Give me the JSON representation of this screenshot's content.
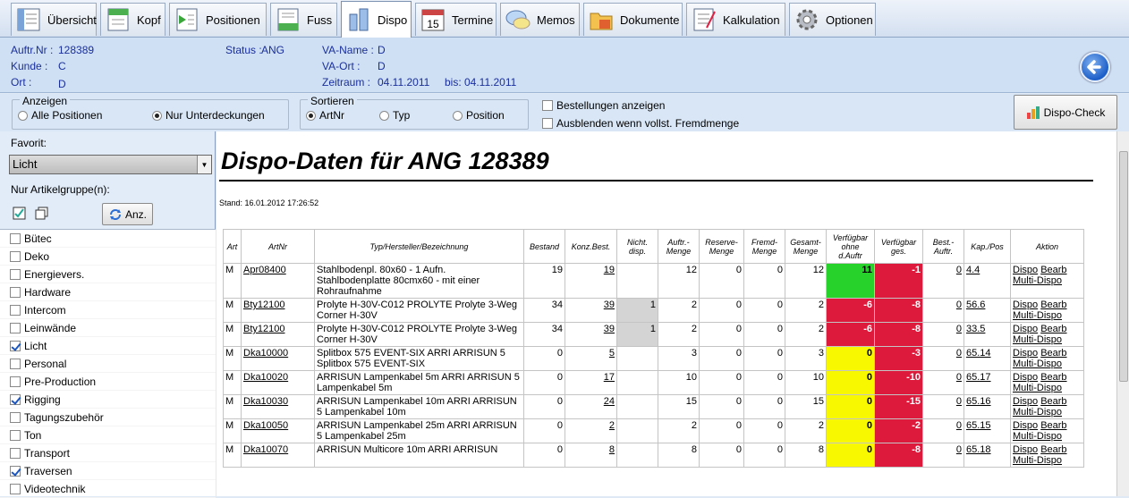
{
  "tabs": [
    {
      "label": "Übersicht",
      "icon": "overview-icon"
    },
    {
      "label": "Kopf",
      "icon": "head-icon"
    },
    {
      "label": "Positionen",
      "icon": "positions-icon"
    },
    {
      "label": "Fuss",
      "icon": "footer-icon"
    },
    {
      "label": "Dispo",
      "icon": "dispo-icon",
      "active": true
    },
    {
      "label": "Termine",
      "icon": "calendar-icon",
      "day": "15"
    },
    {
      "label": "Memos",
      "icon": "memo-icon"
    },
    {
      "label": "Dokumente",
      "icon": "folder-icon"
    },
    {
      "label": "Kalkulation",
      "icon": "calculation-icon"
    },
    {
      "label": "Optionen",
      "icon": "gear-icon"
    }
  ],
  "info": {
    "auftr_label": "Auftr.Nr :",
    "auftr_value": "128389",
    "kunde_label": "Kunde :",
    "kunde_value": "C",
    "ort_label": "Ort :",
    "ort_value": "D",
    "status_label": "Status :",
    "status_value": "ANG",
    "vaname_label": "VA-Name :",
    "vaname_value": "D",
    "vaort_label": "VA-Ort :",
    "vaort_value": "D",
    "zeitraum_label": "Zeitraum :",
    "zeitraum_from": "04.11.2011",
    "bis_label": "bis:",
    "bis_value": "04.11.2011"
  },
  "options": {
    "anzeigen_label": "Anzeigen",
    "alle_positionen": "Alle Positionen",
    "nur_unterdeckungen": "Nur Unterdeckungen",
    "sortieren_label": "Sortieren",
    "sort_artnr": "ArtNr",
    "sort_typ": "Typ",
    "sort_position": "Position",
    "bestellungen": "Bestellungen anzeigen",
    "ausblenden": "Ausblenden wenn vollst. Fremdmenge",
    "dispo_check": "Dispo-Check"
  },
  "sidebar": {
    "favorit_label": "Favorit:",
    "favorit_value": "Licht",
    "nur_artikelgruppe": "Nur Artikelgruppe(n):",
    "anz_label": "Anz.",
    "groups": [
      {
        "label": "Bütec",
        "checked": false
      },
      {
        "label": "Deko",
        "checked": false
      },
      {
        "label": "Energievers.",
        "checked": false
      },
      {
        "label": "Hardware",
        "checked": false
      },
      {
        "label": "Intercom",
        "checked": false
      },
      {
        "label": "Leinwände",
        "checked": false
      },
      {
        "label": "Licht",
        "checked": true
      },
      {
        "label": "Personal",
        "checked": false
      },
      {
        "label": "Pre-Production",
        "checked": false
      },
      {
        "label": "Rigging",
        "checked": true
      },
      {
        "label": "Tagungszubehör",
        "checked": false
      },
      {
        "label": "Ton",
        "checked": false
      },
      {
        "label": "Transport",
        "checked": false
      },
      {
        "label": "Traversen",
        "checked": true
      },
      {
        "label": "Videotechnik",
        "checked": false
      }
    ]
  },
  "report": {
    "title": "Dispo-Daten für ANG 128389",
    "stand": "Stand: 16.01.2012 17:26:52",
    "columns": [
      "Art",
      "ArtNr",
      "Typ/Hersteller/Bezeichnung",
      "Bestand",
      "Konz.Best.",
      "Nicht. disp.",
      "Auftr.- Menge",
      "Reserve- Menge",
      "Fremd- Menge",
      "Gesamt- Menge",
      "Verfügbar ohne d.Auftr",
      "Verfügbar ges.",
      "Best.- Auftr.",
      "Kap./Pos",
      "Aktion"
    ],
    "action_dispo": "Dispo",
    "action_bearb": "Bearb",
    "action_multi": "Multi-Dispo",
    "rows": [
      {
        "art": "M",
        "artnr": "Apr08400",
        "desc": "Stahlbodenpl. 80x60 - 1 Aufn. Stahlbodenplatte 80cmx60 - mit einer Rohraufnahme",
        "bestand": "19",
        "konz": "19",
        "nicht": "",
        "auftr": "12",
        "reserve": "0",
        "fremd": "0",
        "gesamt": "12",
        "verf_ohne": "11",
        "verf_ges": "-1",
        "best": "0",
        "kap": "4.4",
        "c_ohne": "green",
        "c_nicht": ""
      },
      {
        "art": "M",
        "artnr": "Bty12100",
        "desc": "Prolyte H-30V-C012 PROLYTE Prolyte 3-Weg Corner H-30V",
        "bestand": "34",
        "konz": "39",
        "nicht": "1",
        "auftr": "2",
        "reserve": "0",
        "fremd": "0",
        "gesamt": "2",
        "verf_ohne": "-6",
        "verf_ges": "-8",
        "best": "0",
        "kap": "56.6",
        "c_ohne": "red",
        "c_nicht": "gray"
      },
      {
        "art": "M",
        "artnr": "Bty12100",
        "desc": "Prolyte H-30V-C012 PROLYTE Prolyte 3-Weg Corner H-30V",
        "bestand": "34",
        "konz": "39",
        "nicht": "1",
        "auftr": "2",
        "reserve": "0",
        "fremd": "0",
        "gesamt": "2",
        "verf_ohne": "-6",
        "verf_ges": "-8",
        "best": "0",
        "kap": "33.5",
        "c_ohne": "red",
        "c_nicht": "gray"
      },
      {
        "art": "M",
        "artnr": "Dka10000",
        "desc": "Splitbox 575 EVENT-SIX ARRI ARRISUN 5 Splitbox 575 EVENT-SIX",
        "bestand": "0",
        "konz": "5",
        "nicht": "",
        "auftr": "3",
        "reserve": "0",
        "fremd": "0",
        "gesamt": "3",
        "verf_ohne": "0",
        "verf_ges": "-3",
        "best": "0",
        "kap": "65.14",
        "c_ohne": "yellow",
        "c_nicht": ""
      },
      {
        "art": "M",
        "artnr": "Dka10020",
        "desc": "ARRISUN Lampenkabel 5m ARRI ARRISUN 5 Lampenkabel 5m",
        "bestand": "0",
        "konz": "17",
        "nicht": "",
        "auftr": "10",
        "reserve": "0",
        "fremd": "0",
        "gesamt": "10",
        "verf_ohne": "0",
        "verf_ges": "-10",
        "best": "0",
        "kap": "65.17",
        "c_ohne": "yellow",
        "c_nicht": ""
      },
      {
        "art": "M",
        "artnr": "Dka10030",
        "desc": "ARRISUN Lampenkabel 10m ARRI ARRISUN 5 Lampenkabel 10m",
        "bestand": "0",
        "konz": "24",
        "nicht": "",
        "auftr": "15",
        "reserve": "0",
        "fremd": "0",
        "gesamt": "15",
        "verf_ohne": "0",
        "verf_ges": "-15",
        "best": "0",
        "kap": "65.16",
        "c_ohne": "yellow",
        "c_nicht": ""
      },
      {
        "art": "M",
        "artnr": "Dka10050",
        "desc": "ARRISUN Lampenkabel 25m ARRI ARRISUN 5 Lampenkabel 25m",
        "bestand": "0",
        "konz": "2",
        "nicht": "",
        "auftr": "2",
        "reserve": "0",
        "fremd": "0",
        "gesamt": "2",
        "verf_ohne": "0",
        "verf_ges": "-2",
        "best": "0",
        "kap": "65.15",
        "c_ohne": "yellow",
        "c_nicht": ""
      },
      {
        "art": "M",
        "artnr": "Dka10070",
        "desc": "ARRISUN Multicore 10m ARRI ARRISUN",
        "bestand": "0",
        "konz": "8",
        "nicht": "",
        "auftr": "8",
        "reserve": "0",
        "fremd": "0",
        "gesamt": "8",
        "verf_ohne": "0",
        "verf_ges": "-8",
        "best": "0",
        "kap": "65.18",
        "c_ohne": "yellow",
        "c_nicht": ""
      }
    ]
  },
  "colors": {
    "green": "#27d32a",
    "red": "#dd1a3c",
    "yellow": "#f8f800",
    "gray": "#d4d4d4"
  }
}
